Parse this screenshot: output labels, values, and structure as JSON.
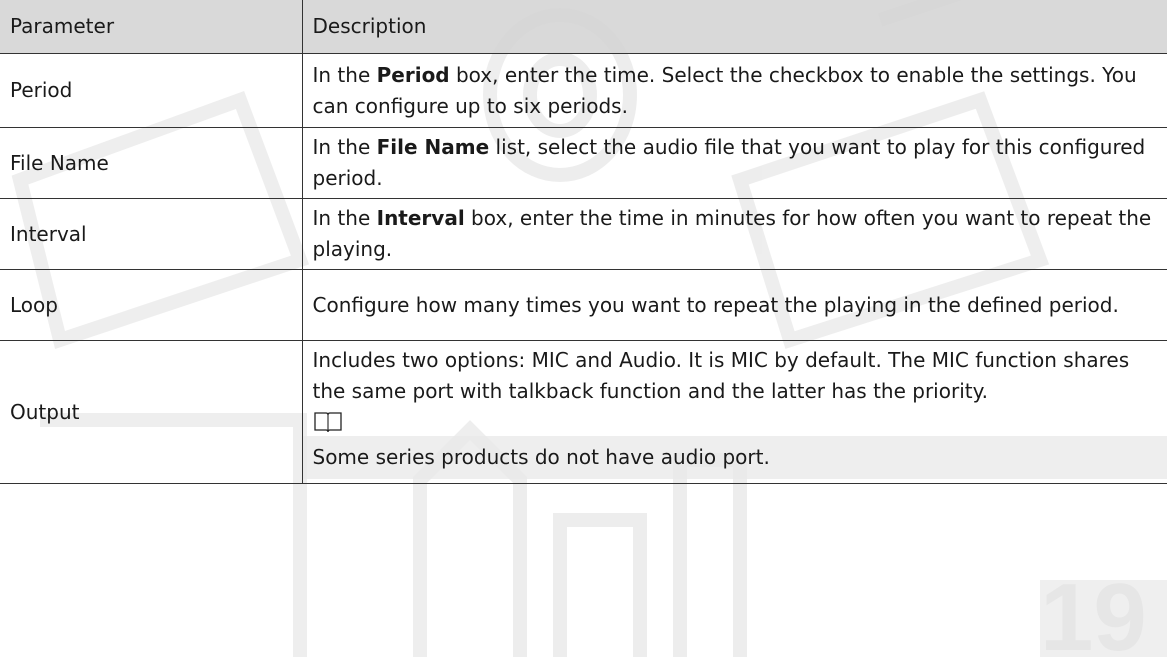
{
  "table": {
    "headers": [
      "Parameter",
      "Description"
    ],
    "rows": [
      {
        "param": "Period",
        "desc_prefix": "In the ",
        "desc_bold": "Period",
        "desc_suffix": " box, enter the time. Select the checkbox to enable the settings. You can configure up to six periods."
      },
      {
        "param": "File Name",
        "desc_prefix": "In the ",
        "desc_bold": "File Name",
        "desc_suffix": " list, select the audio file that you want to play for this configured period."
      },
      {
        "param": "Interval",
        "desc_prefix": "In the ",
        "desc_bold": "Interval",
        "desc_suffix": " box, enter the time in minutes for how often you want to repeat the playing."
      },
      {
        "param": "Loop",
        "desc": "Configure how many times you want to repeat the playing in the defined period."
      },
      {
        "param": "Output",
        "desc": "Includes two options: MIC and Audio. It is MIC by default. The MIC function shares the same port with talkback function and the latter has the priority.",
        "note_icon": "book-note-icon",
        "note": "Some series products do not have audio port."
      }
    ]
  },
  "colors": {
    "header_bg": "#d4d4d4",
    "border": "#333333",
    "text": "#1a1a1a"
  }
}
